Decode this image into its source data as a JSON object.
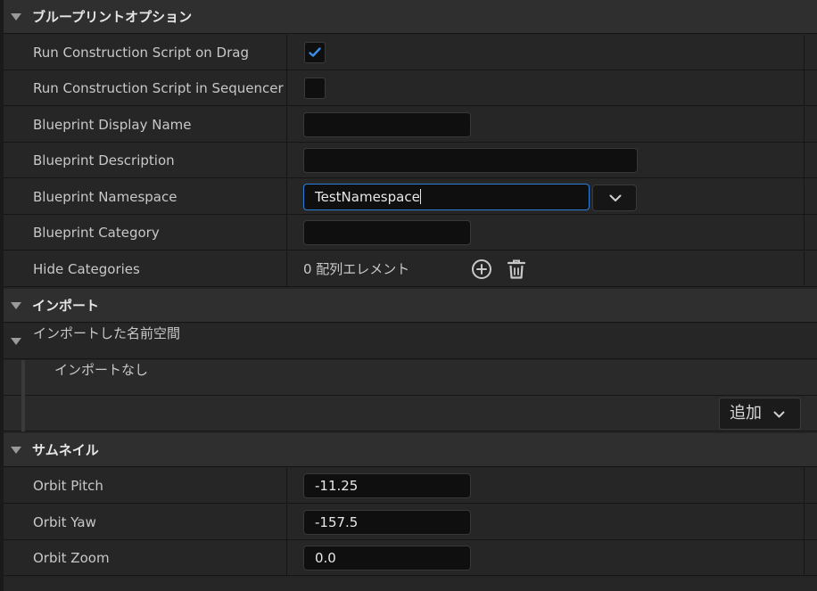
{
  "sections": {
    "blueprint_options": {
      "title": "ブループリントオプション",
      "run_on_drag": {
        "label": "Run Construction Script on Drag",
        "checked": true
      },
      "run_in_sequencer": {
        "label": "Run Construction Script in Sequencer",
        "checked": false
      },
      "display_name": {
        "label": "Blueprint Display Name",
        "value": ""
      },
      "description": {
        "label": "Blueprint Description",
        "value": ""
      },
      "namespace": {
        "label": "Blueprint Namespace",
        "value": "TestNamespace"
      },
      "category": {
        "label": "Blueprint Category",
        "value": ""
      },
      "hide_categories": {
        "label": "Hide Categories",
        "count_text": "0 配列エレメント"
      }
    },
    "imports": {
      "title": "インポート",
      "imported_namespaces": {
        "label": "インポートした名前空間",
        "empty_text": "インポートなし"
      },
      "add_label": "追加"
    },
    "thumbnail": {
      "title": "サムネイル",
      "orbit_pitch": {
        "label": "Orbit Pitch",
        "value": "-11.25"
      },
      "orbit_yaw": {
        "label": "Orbit Yaw",
        "value": "-157.5"
      },
      "orbit_zoom": {
        "label": "Orbit Zoom",
        "value": "0.0"
      }
    }
  },
  "colors": {
    "accent": "#2a7fd8",
    "checkmark": "#3a8ee6"
  },
  "icons": [
    "collapse-triangle-icon",
    "checkmark-icon",
    "chevron-down-icon",
    "add-circle-icon",
    "trash-icon"
  ]
}
